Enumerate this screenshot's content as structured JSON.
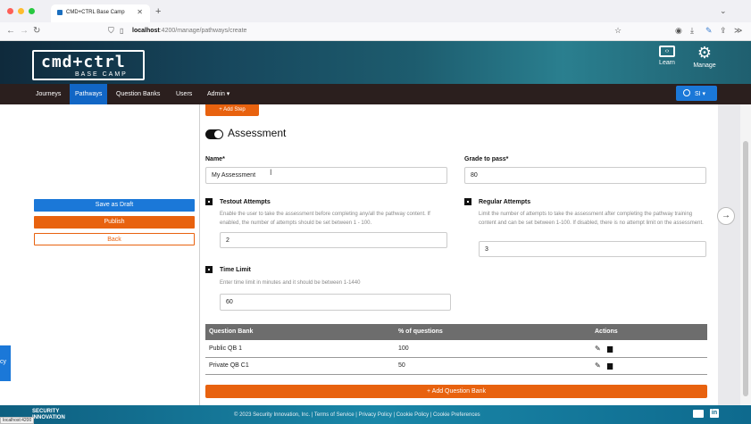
{
  "browser": {
    "tab_title": "CMD+CTRL Base Camp",
    "tab_close": "✕",
    "new_tab": "+",
    "url_host": "localhost",
    "url_path": ":4200/manage/pathways/create"
  },
  "header": {
    "logo_main": "cmd+ctrl",
    "logo_sub": "BASE CAMP",
    "learn_label": "Learn",
    "manage_label": "Manage"
  },
  "nav": {
    "items": [
      "Journeys",
      "Pathways",
      "Question Banks",
      "Users",
      "Admin ▾"
    ],
    "active": "Pathways",
    "user_label": "SI ▾"
  },
  "sidebar": {
    "save_draft": "Save as Draft",
    "publish": "Publish",
    "back": "Back",
    "edge_text": "cy"
  },
  "main": {
    "add_step": "+ Add Step",
    "assessment_title": "Assessment",
    "name_label": "Name*",
    "name_value": "My Assessment",
    "grade_label": "Grade to pass*",
    "grade_value": "80",
    "testout_label": "Testout Attempts",
    "testout_help": "Enable the user to take the assessment before completing any/all the pathway content. If enabled, the number of attempts should be set between 1 - 100.",
    "testout_value": "2",
    "regular_label": "Regular Attempts",
    "regular_help": "Limit the number of attempts to take the assessment after completing the pathway training content and can be set between 1-100. If disabled, there is no attempt limit on the assessment.",
    "regular_value": "3",
    "timelimit_label": "Time Limit",
    "timelimit_help": "Enter time limit in minutes and it should be between 1-1440",
    "timelimit_value": "60",
    "table": {
      "headers": [
        "Question Bank",
        "% of questions",
        "Actions"
      ],
      "rows": [
        {
          "bank": "Public QB 1",
          "percent": "100"
        },
        {
          "bank": "Private QB C1",
          "percent": "50"
        }
      ]
    },
    "add_question_bank": "+ Add Question Bank"
  },
  "footer": {
    "brand": "SECURITY INNOVATION",
    "text": "© 2023 Security Innovation, Inc. | Terms of Service | Privacy Policy | Cookie Policy | Cookie Preferences",
    "status_url": "localhost:4200"
  },
  "colors": {
    "accent_blue": "#1166c5",
    "accent_orange": "#e8620f"
  }
}
